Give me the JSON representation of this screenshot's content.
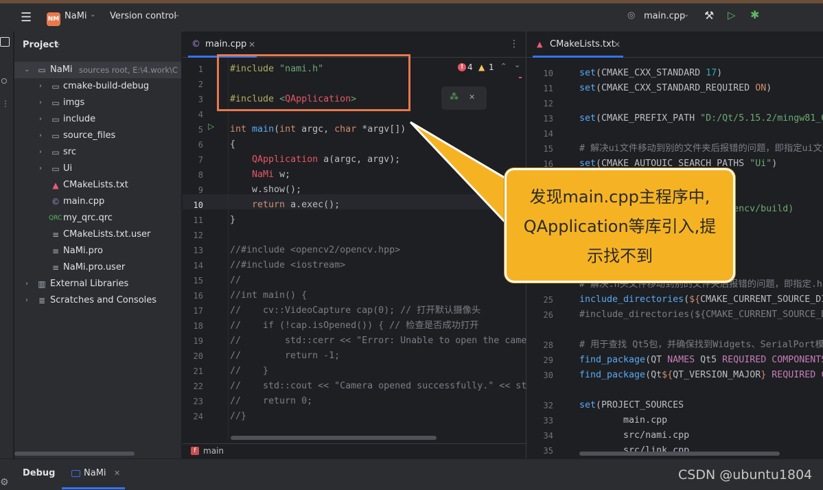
{
  "topbar": {
    "project_badge": "NM",
    "project_name": "NaMi",
    "vcs_label": "Version control",
    "run_config": "main.cpp"
  },
  "project_panel": {
    "title": "Project",
    "items": [
      {
        "label": "NaMi",
        "hint": "sources root,  E:\\4.work\\C",
        "type": "root"
      },
      {
        "label": "cmake-build-debug",
        "type": "folder"
      },
      {
        "label": "imgs",
        "type": "folder"
      },
      {
        "label": "include",
        "type": "folder"
      },
      {
        "label": "source_files",
        "type": "folder"
      },
      {
        "label": "src",
        "type": "folder"
      },
      {
        "label": "Ui",
        "type": "folder"
      },
      {
        "label": "CMakeLists.txt",
        "type": "cmake"
      },
      {
        "label": "main.cpp",
        "type": "cpp"
      },
      {
        "label": "my_qrc.qrc",
        "type": "qrc"
      },
      {
        "label": "CMakeLists.txt.user",
        "type": "file"
      },
      {
        "label": "NaMi.pro",
        "type": "file"
      },
      {
        "label": "NaMi.pro.user",
        "type": "file"
      },
      {
        "label": "External Libraries",
        "type": "lib"
      },
      {
        "label": "Scratches and Consoles",
        "type": "scratch"
      }
    ]
  },
  "editor_left": {
    "tab": "main.cpp",
    "errors": "4",
    "warnings": "1",
    "breadcrumb": "main",
    "line_numbers": [
      "1",
      "2",
      "3",
      "4",
      "5",
      "6",
      "7",
      "8",
      "9",
      "10",
      "11",
      "12",
      "13",
      "14",
      "15",
      "16",
      "17",
      "18",
      "19",
      "20",
      "21",
      "22",
      "23",
      "24"
    ]
  },
  "editor_right": {
    "tab": "CMakeLists.txt",
    "line_numbers": [
      "10",
      "11",
      "12",
      "13",
      "14",
      "15",
      "16",
      "",
      "",
      "",
      "",
      "",
      "",
      "",
      "",
      "25",
      "26",
      "",
      "28",
      "29",
      "30",
      "",
      "32",
      "33",
      "34",
      "35"
    ]
  },
  "callout": {
    "line1": "发现main.cpp主程序中,",
    "line2": "QApplication等库引入,提",
    "line3": "示找不到"
  },
  "debug_bar": {
    "title": "Debug",
    "tab": "NaMi"
  },
  "watermark": "CSDN @ubuntu1804",
  "colors": {
    "accent": "#3574f0",
    "callout_bg": "#f5b324",
    "highlight_box": "#e8794d",
    "error": "#e55765",
    "warning": "#f2c55c"
  }
}
